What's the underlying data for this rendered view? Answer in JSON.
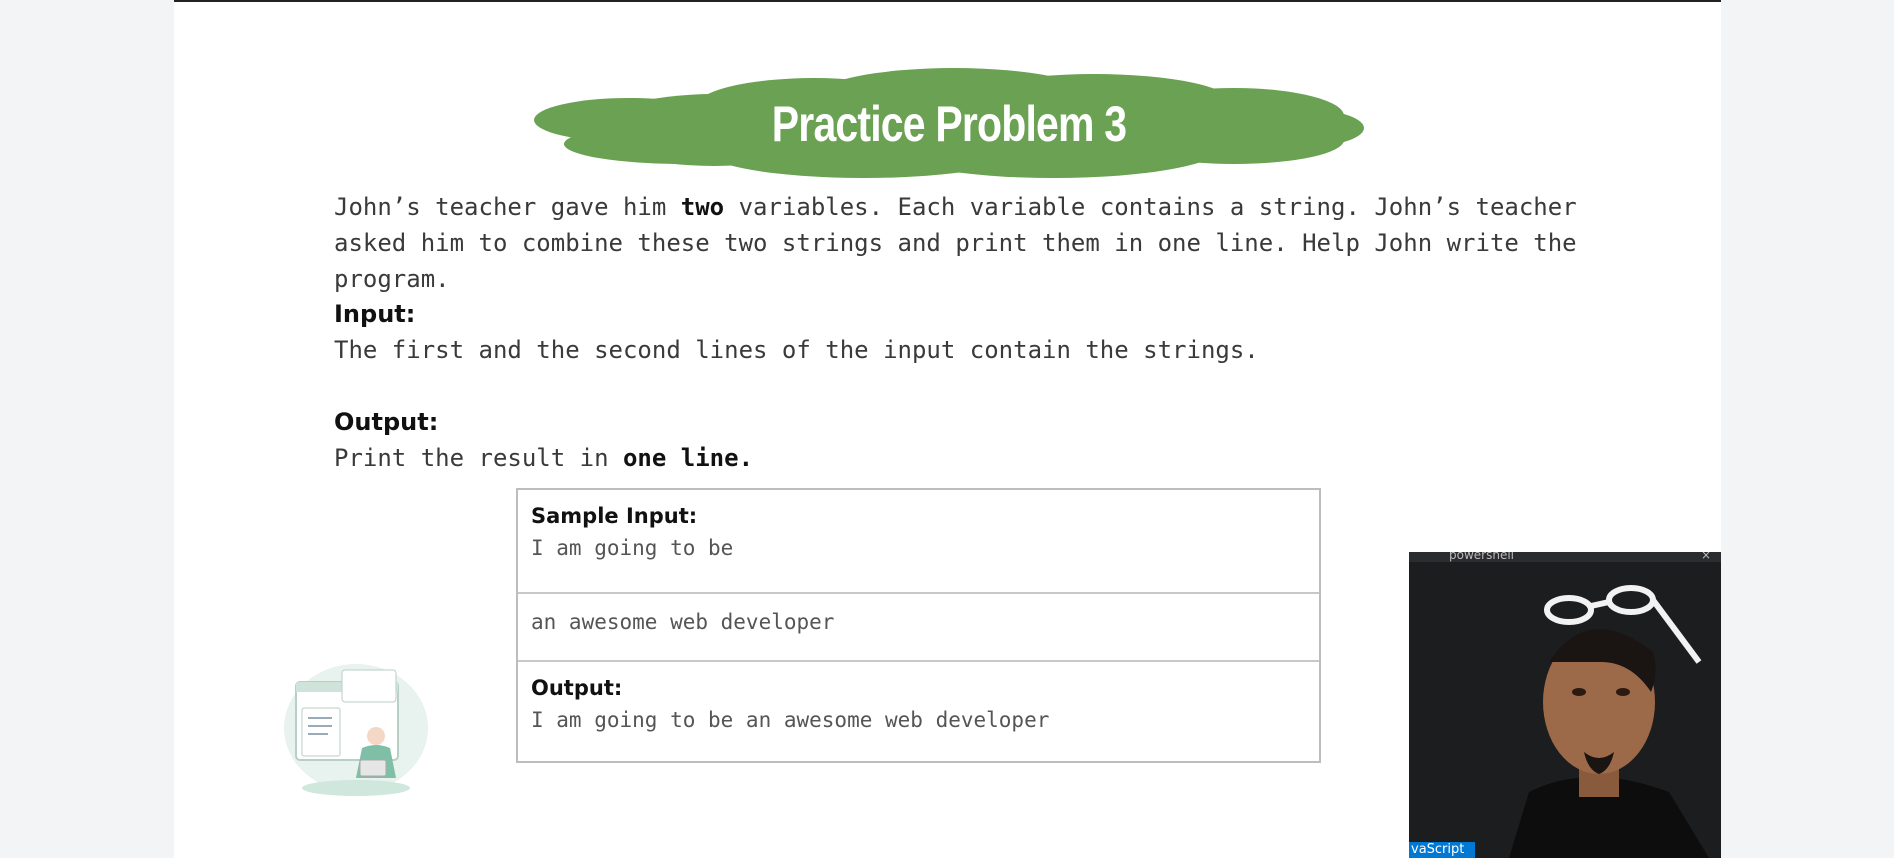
{
  "slide": {
    "title": "Practice Problem 3",
    "description_parts": [
      "John’s teacher gave him ",
      "two",
      " variables. Each variable contains a string. John’s teacher asked him to combine these two strings and print them in one line. Help John write the program."
    ],
    "input_label": "Input:",
    "input_text": "The first and the second lines of the input contain the strings.",
    "output_label": "Output:",
    "output_text_prefix": "Print the result in ",
    "output_text_emphasis": "one line.",
    "sample": {
      "input_label": "Sample Input:",
      "input_line1": "I am going to be",
      "input_line2": "an awesome web developer",
      "output_label": "Output:",
      "output_line": "I am going to be an awesome web developer"
    }
  },
  "webcam": {
    "titlebar_label": "powershell",
    "close_glyph": "×",
    "tab_label": "vaScript"
  },
  "colors": {
    "cloud_green": "#6aa152",
    "slide_bg": "#ffffff",
    "page_bg": "#f2f4f6",
    "webcam_bg": "#1c1d1f",
    "tab_blue": "#0078d4"
  }
}
